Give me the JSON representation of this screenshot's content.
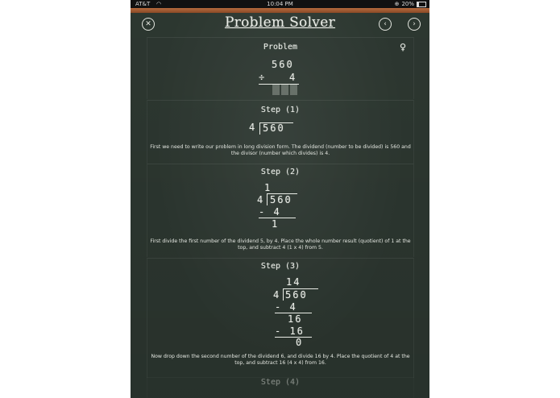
{
  "status_bar": {
    "carrier": "AT&T",
    "time": "10:04 PM",
    "battery": "20%"
  },
  "header": {
    "title": "Problem Solver",
    "close_icon": "close-icon",
    "back_icon": "chevron-left-icon",
    "forward_icon": "chevron-right-icon"
  },
  "problem": {
    "heading": "Problem",
    "dividend": "560",
    "operator": "÷",
    "divisor": "4"
  },
  "steps": [
    {
      "heading": "Step (1)",
      "lines": [
        "4",
        "560"
      ],
      "description": "First we need to write our problem in long division form. The dividend (number to be divided) is 560 and the divisor (number which divides) is 4."
    },
    {
      "heading": "Step (2)",
      "quotient": "1",
      "divisor": "4",
      "dividend": "560",
      "sub": "- 4",
      "result": "1",
      "description": "First divide the first number of the dividend 5, by 4. Place the whole number result (quotient) of 1 at the top, and subtract 4 (1 x 4) from 5."
    },
    {
      "heading": "Step (3)",
      "quotient": "14",
      "divisor": "4",
      "dividend": "560",
      "sub1": "- 4",
      "mid": "16",
      "sub2": "- 16",
      "result": "0",
      "description": "Now drop down the second number of the dividend 6, and divide 16 by 4. Place the quotient of 4 at the top, and subtract 16 (4 x 4) from 16."
    },
    {
      "heading": "Step (4)"
    }
  ]
}
